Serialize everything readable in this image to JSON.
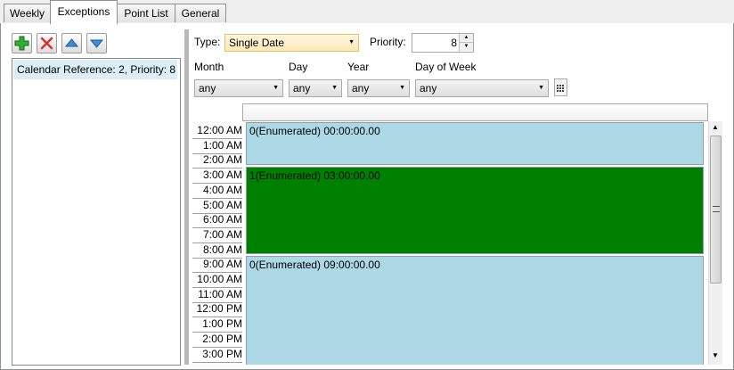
{
  "tabs": [
    {
      "label": "Weekly"
    },
    {
      "label": "Exceptions"
    },
    {
      "label": "Point List"
    },
    {
      "label": "General"
    }
  ],
  "toolbar": {
    "add_icon": "plus-icon",
    "delete_icon": "x-icon",
    "up_icon": "arrow-up-icon",
    "down_icon": "arrow-down-icon"
  },
  "exceptions_list": [
    {
      "label": "Calendar Reference: 2, Priority: 8"
    }
  ],
  "form": {
    "type_label": "Type:",
    "type_value": "Single Date",
    "priority_label": "Priority:",
    "priority_value": "8",
    "month_label": "Month",
    "day_label": "Day",
    "year_label": "Year",
    "dow_label": "Day of Week",
    "month_value": "any",
    "day_value": "any",
    "year_value": "any",
    "dow_value": "any"
  },
  "times": [
    "12:00 AM",
    "1:00 AM",
    "2:00 AM",
    "3:00 AM",
    "4:00 AM",
    "5:00 AM",
    "6:00 AM",
    "7:00 AM",
    "8:00 AM",
    "9:00 AM",
    "10:00 AM",
    "11:00 AM",
    "12:00 PM",
    "1:00 PM",
    "2:00 PM",
    "3:00 PM"
  ],
  "schedule_blocks": [
    {
      "label": "0(Enumerated) 00:00:00.00",
      "color": "#add8e6"
    },
    {
      "label": "1(Enumerated) 03:00:00.00",
      "color": "#008000"
    },
    {
      "label": "0(Enumerated) 09:00:00.00",
      "color": "#add8e6"
    }
  ],
  "colors": {
    "selection": "#dbeef6",
    "accent_border": "#e5c365"
  }
}
